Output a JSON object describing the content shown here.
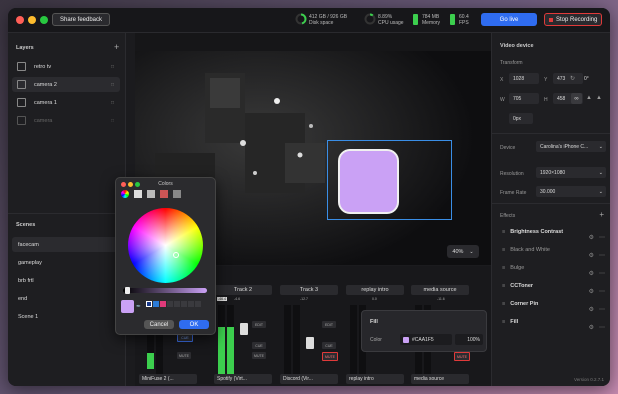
{
  "header": {
    "share_label": "Share feedback",
    "disk_value": "412 GB / 926 GB",
    "disk_label": "Disk space",
    "cpu_value": "8.89%",
    "cpu_label": "CPU usage",
    "mem_value": "784 MB",
    "mem_label": "Memory",
    "fps_value": "60.4",
    "fps_label": "FPS",
    "go_live_label": "Go live",
    "stop_label": "Stop Recording"
  },
  "layers": {
    "title": "Layers",
    "items": [
      {
        "label": "retro tv"
      },
      {
        "label": "camera 2"
      },
      {
        "label": "camera 1"
      },
      {
        "label": "camera"
      }
    ]
  },
  "scenes": {
    "title": "Scenes",
    "items": [
      {
        "label": "facecam"
      },
      {
        "label": "gameplay"
      },
      {
        "label": "brb frtl"
      },
      {
        "label": "end"
      },
      {
        "label": "Scene 1"
      }
    ]
  },
  "canvas": {
    "zoom": "40%"
  },
  "video_device": {
    "title": "Video device",
    "transform_label": "Transform",
    "x_label": "X",
    "x_value": "1028",
    "y_label": "Y",
    "y_value": "473",
    "rot_value": "0°",
    "w_label": "W",
    "w_value": "705",
    "h_label": "H",
    "h_value": "458",
    "radius_value": "0px",
    "device_label": "Device",
    "device_value": "Carolina's iPhone C...",
    "resolution_label": "Resolution",
    "resolution_value": "1920×1080",
    "framerate_label": "Frame Rate",
    "framerate_value": "30.000",
    "effects_label": "Effects",
    "effects": [
      {
        "label": "Brightness Contrast"
      },
      {
        "label": "Black and White"
      },
      {
        "label": "Bulge"
      },
      {
        "label": "CCToner"
      },
      {
        "label": "Corner Pin"
      },
      {
        "label": "Fill"
      }
    ]
  },
  "fill_panel": {
    "title": "Fill",
    "color_label": "Color",
    "color_hex": "#CAA1F5",
    "opacity": "100%"
  },
  "tracks": [
    {
      "name": "",
      "footer": "MiniFuse 2 (...",
      "db": "-22"
    },
    {
      "name": "Track 2",
      "footer": "Spotify (Virt...",
      "db": "-46.4",
      "db2": "-4.6"
    },
    {
      "name": "Track 3",
      "footer": "Discord (Vir...",
      "db": "-12.7"
    },
    {
      "name": "replay intro",
      "footer": "replay intro",
      "db": "0.0"
    },
    {
      "name": "media source",
      "footer": "media source",
      "db": "-11.6"
    }
  ],
  "track_buttons": {
    "cue": "CUE",
    "edit": "EDIT",
    "mute": "MUTE"
  },
  "color_picker": {
    "title": "Colors",
    "cancel_label": "Cancel",
    "ok_label": "OK"
  },
  "footer": {
    "version": "Version 0.2.7.1"
  },
  "colors": {
    "accent": "#2f6cf0",
    "fill": "#CAA1F5",
    "stop": "#e03a3a",
    "meter_green": "#3ccf4e"
  }
}
